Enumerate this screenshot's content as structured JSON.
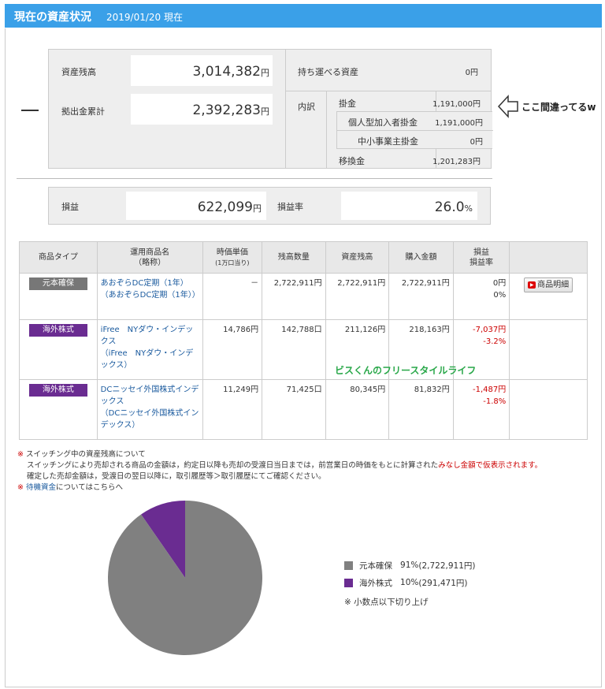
{
  "header": {
    "title": "現在の資産状況",
    "date": "2019/01/20  現在"
  },
  "summary": {
    "balance_label": "資産残高",
    "balance_value": "3,014,382",
    "balance_unit": "円",
    "contrib_label": "拠出金累計",
    "contrib_value": "2,392,283",
    "contrib_unit": "円",
    "portable_label": "持ち運べる資産",
    "portable_value": "0円",
    "breakdown_label": "内訳",
    "kakekin_label": "掛金",
    "kakekin_value": "1,191,000円",
    "individual_label": "個人型加入者掛金",
    "individual_value": "1,191,000円",
    "sme_label": "中小事業主掛金",
    "sme_value": "0円",
    "transfer_label": "移換金",
    "transfer_value": "1,201,283円",
    "profit_label": "損益",
    "profit_value": "622,099",
    "profit_unit": "円",
    "rate_label": "損益率",
    "rate_value": "26.0",
    "rate_unit": "%"
  },
  "annotation": {
    "text": "ここ間違ってるw"
  },
  "table": {
    "headers": {
      "type": "商品タイプ",
      "name": "運用商品名",
      "name_sub": "（略称）",
      "price": "時価単価",
      "price_sub": "(1万口当り)",
      "qty": "残高数量",
      "balance": "資産残高",
      "purchase": "購入金額",
      "pl": "損益",
      "pl_rate": "損益率"
    },
    "rows": [
      {
        "type": "元本確保",
        "type_color": "#777777",
        "name": "あおぞらDC定期（1年）",
        "short": "（あおぞらDC定期（1年））",
        "price": "－",
        "qty": "2,722,911円",
        "balance": "2,722,911円",
        "purchase": "2,722,911円",
        "pl": "0円",
        "rate": "0%",
        "detail": "商品明細"
      },
      {
        "type": "海外株式",
        "type_color": "#6a2c91",
        "name": "iFree　NYダウ・インデックス",
        "short": "（iFree　NYダウ・インデックス）",
        "price": "14,786円",
        "qty": "142,788口",
        "balance": "211,126円",
        "purchase": "218,163円",
        "pl": "-7,037円",
        "rate": "-3.2%"
      },
      {
        "type": "海外株式",
        "type_color": "#6a2c91",
        "name": "DCニッセイ外国株式インデックス",
        "short": "（DCニッセイ外国株式インデックス）",
        "price": "11,249円",
        "qty": "71,425口",
        "balance": "80,345円",
        "purchase": "81,832円",
        "pl": "-1,487円",
        "rate": "-1.8%"
      }
    ]
  },
  "watermark": "ビスくんのフリースタイルライフ",
  "notes": {
    "mark": "※",
    "switching_title": "スイッチング中の資産残高について",
    "line1a": "スイッチングにより売却される商品の金額は，約定日以降も売却の受渡日当日までは，前営業日の時価をもとに計算された",
    "line1b": "みなし金額で仮表示されます。",
    "line2": "確定した売却金額は，受渡日の翌日以降に，取引履歴等＞取引履歴にてご確認ください。",
    "standby_link": "待機資金",
    "standby_rest": "についてはこちらへ"
  },
  "chart_data": {
    "type": "pie",
    "categories": [
      "元本確保",
      "海外株式"
    ],
    "values": [
      2722911,
      291471
    ],
    "percent": [
      91,
      10
    ],
    "colors": [
      "#808080",
      "#6a2c91"
    ]
  },
  "legend": {
    "items": [
      {
        "label": "元本確保",
        "pct": "91%",
        "amount": "(2,722,911円)",
        "color": "#808080"
      },
      {
        "label": "海外株式",
        "pct": "10%",
        "amount": "(291,471円)",
        "color": "#6a2c91"
      }
    ],
    "footnote": "※ 小数点以下切り上げ"
  }
}
